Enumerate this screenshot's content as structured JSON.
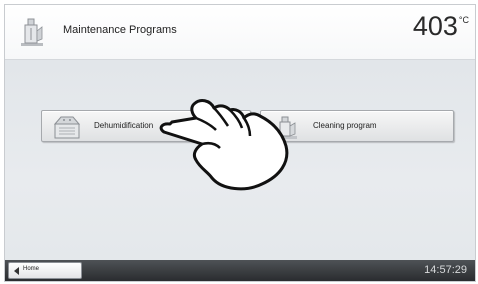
{
  "header": {
    "title": "Maintenance Programs",
    "temperature": "403",
    "temperature_unit": "°C",
    "icon": "maintenance-icon"
  },
  "programs": [
    {
      "label": "Dehumidification",
      "icon": "dehumidification-icon"
    },
    {
      "label": "Cleaning program",
      "icon": "cleaning-icon"
    }
  ],
  "footer": {
    "home_label": "Home",
    "clock": "14:57:29"
  },
  "overlay": {
    "icon": "pointing-hand-icon"
  },
  "colors": {
    "footer_bg": "#3a3d40",
    "content_bg": "#e4e8eb"
  }
}
